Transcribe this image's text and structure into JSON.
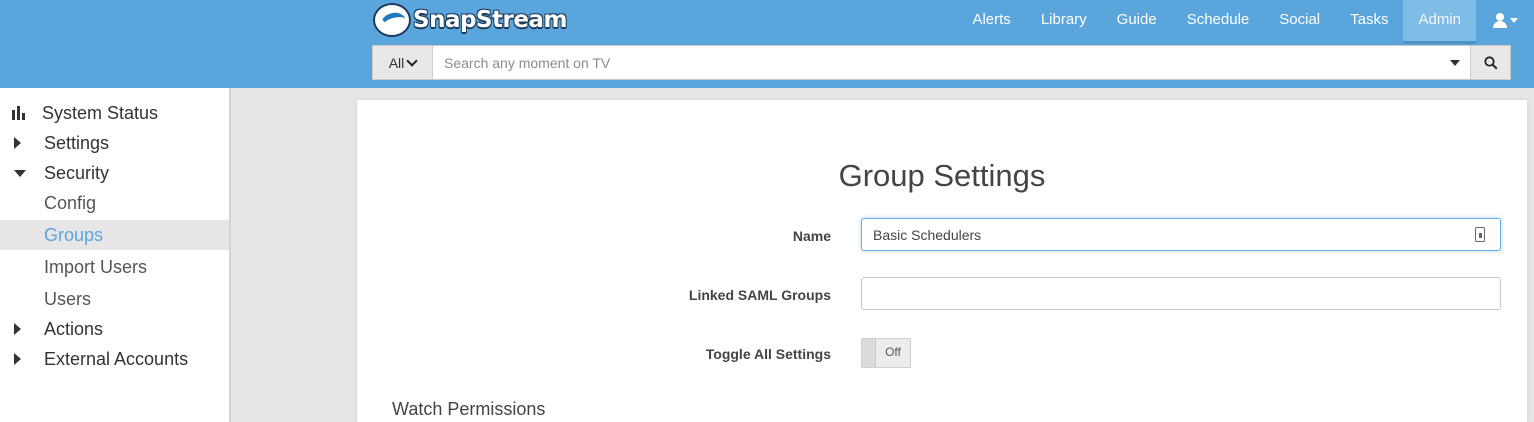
{
  "header": {
    "logo_text": "SnapStream",
    "nav": [
      {
        "label": "Alerts"
      },
      {
        "label": "Library"
      },
      {
        "label": "Guide"
      },
      {
        "label": "Schedule"
      },
      {
        "label": "Social"
      },
      {
        "label": "Tasks"
      },
      {
        "label": "Admin",
        "active": true
      }
    ],
    "search": {
      "scope": "All",
      "placeholder": "Search any moment on TV"
    },
    "colors": {
      "topbar": "#5aa5dc",
      "active_tab": "#7fbce6"
    }
  },
  "sidebar": {
    "items": [
      {
        "label": "System Status",
        "icon": "bar-chart-icon"
      },
      {
        "label": "Settings",
        "icon": "caret-right-icon"
      },
      {
        "label": "Security",
        "icon": "caret-down-icon"
      },
      {
        "label": "Config"
      },
      {
        "label": "Groups",
        "active": true
      },
      {
        "label": "Import Users"
      },
      {
        "label": "Users"
      },
      {
        "label": "Actions",
        "icon": "caret-right-icon"
      },
      {
        "label": "External Accounts",
        "icon": "caret-right-icon"
      }
    ],
    "active_color": "#5aa5dc"
  },
  "main": {
    "title": "Group Settings",
    "fields": {
      "name_label": "Name",
      "name_value": "Basic Schedulers",
      "saml_label": "Linked SAML Groups",
      "saml_value": "",
      "toggle_label": "Toggle All Settings",
      "toggle_state": "Off"
    },
    "section_heading": "Watch Permissions"
  }
}
